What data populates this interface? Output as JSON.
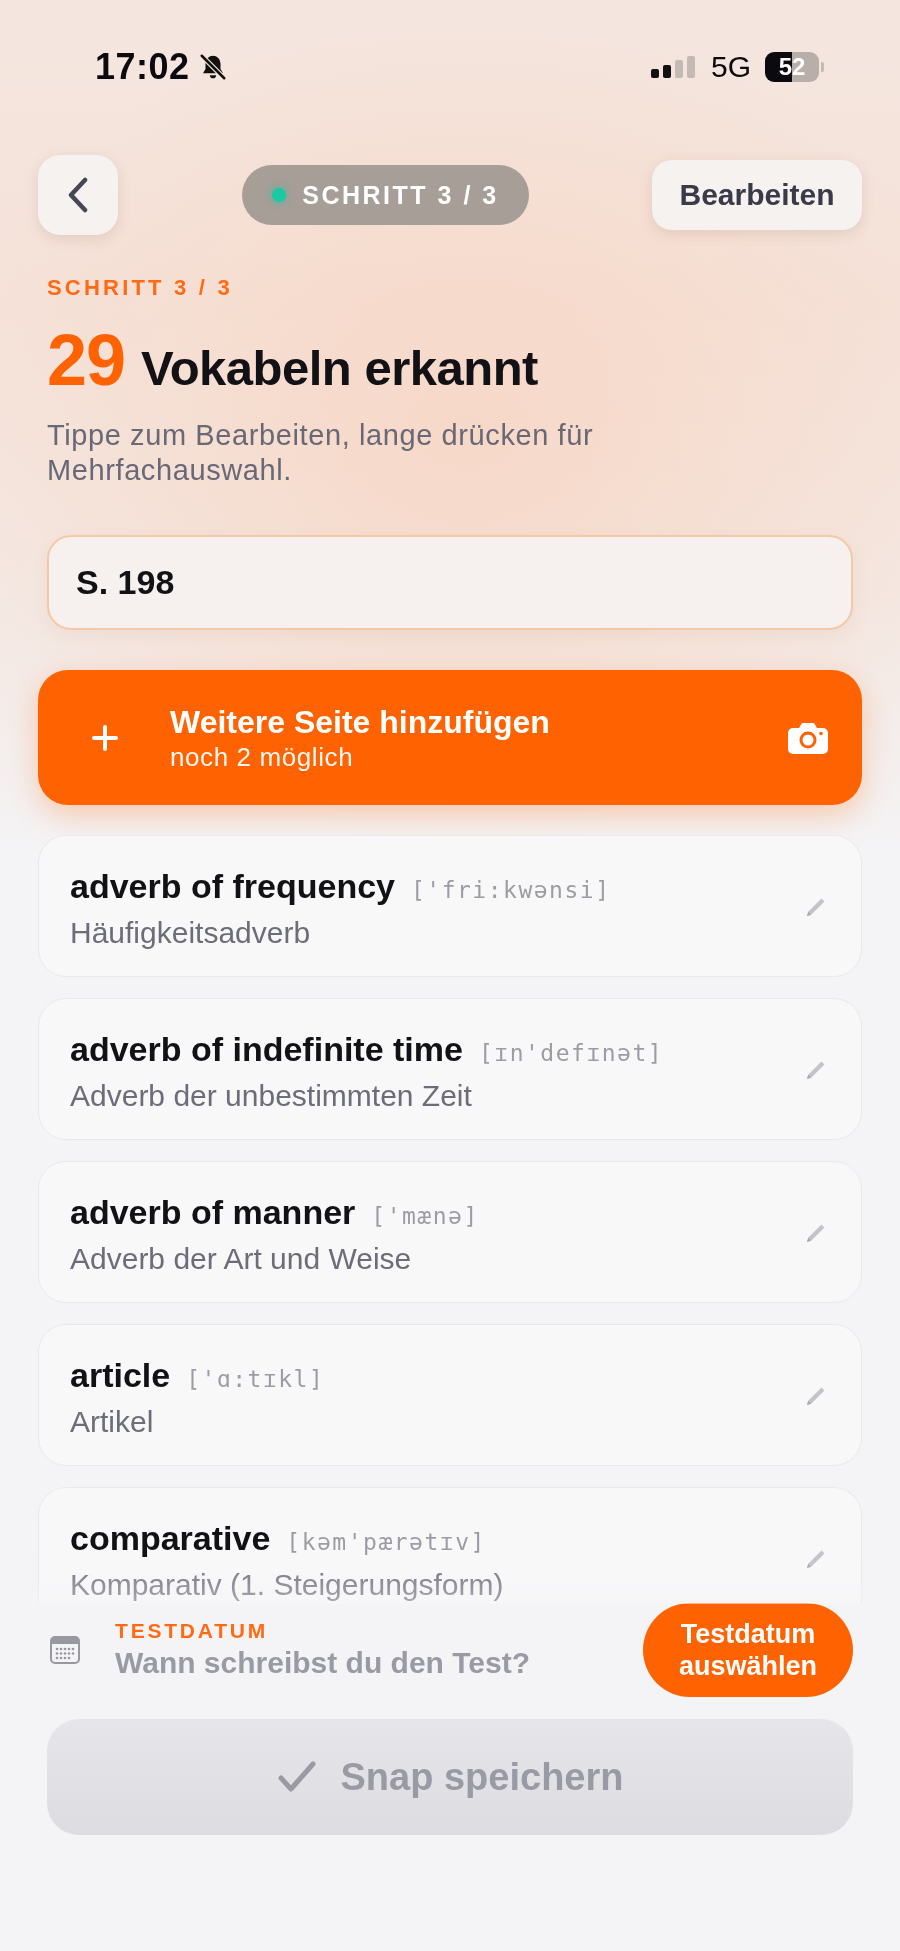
{
  "status_bar": {
    "time": "17:02",
    "network": "5G",
    "battery": "52"
  },
  "header": {
    "step_pill": "SCHRITT 3 / 3",
    "edit_button": "Bearbeiten"
  },
  "intro": {
    "step_label": "SCHRITT 3 / 3",
    "count": "29",
    "title": "Vokabeln erkannt",
    "hint": "Tippe zum Bearbeiten, lange drücken für Mehrfachauswahl."
  },
  "page_field": {
    "value": "S. 198"
  },
  "add_page_button": {
    "title": "Weitere Seite hinzufügen",
    "subtitle": "noch 2 möglich"
  },
  "vocabulary": [
    {
      "word": "adverb of frequency",
      "phonetic": "['fri:kwənsi]",
      "translation": "Häufigkeitsadverb"
    },
    {
      "word": "adverb of indefinite time",
      "phonetic": "[ɪn'defɪnət]",
      "translation": "Adverb der unbestimmten Zeit"
    },
    {
      "word": "adverb of manner",
      "phonetic": "['mænə]",
      "translation": "Adverb der Art und Weise"
    },
    {
      "word": "article",
      "phonetic": "['ɑ:tɪkl]",
      "translation": "Artikel"
    },
    {
      "word": "comparative",
      "phonetic": "[kəm'pærətɪv]",
      "translation": "Komparativ (1. Steigerungsform)"
    }
  ],
  "test_date": {
    "label": "TESTDATUM",
    "prompt": "Wann schreibst du den Test?",
    "button": "Testdatum auswählen"
  },
  "save_button": {
    "label": "Snap speichern",
    "disabled": true
  }
}
